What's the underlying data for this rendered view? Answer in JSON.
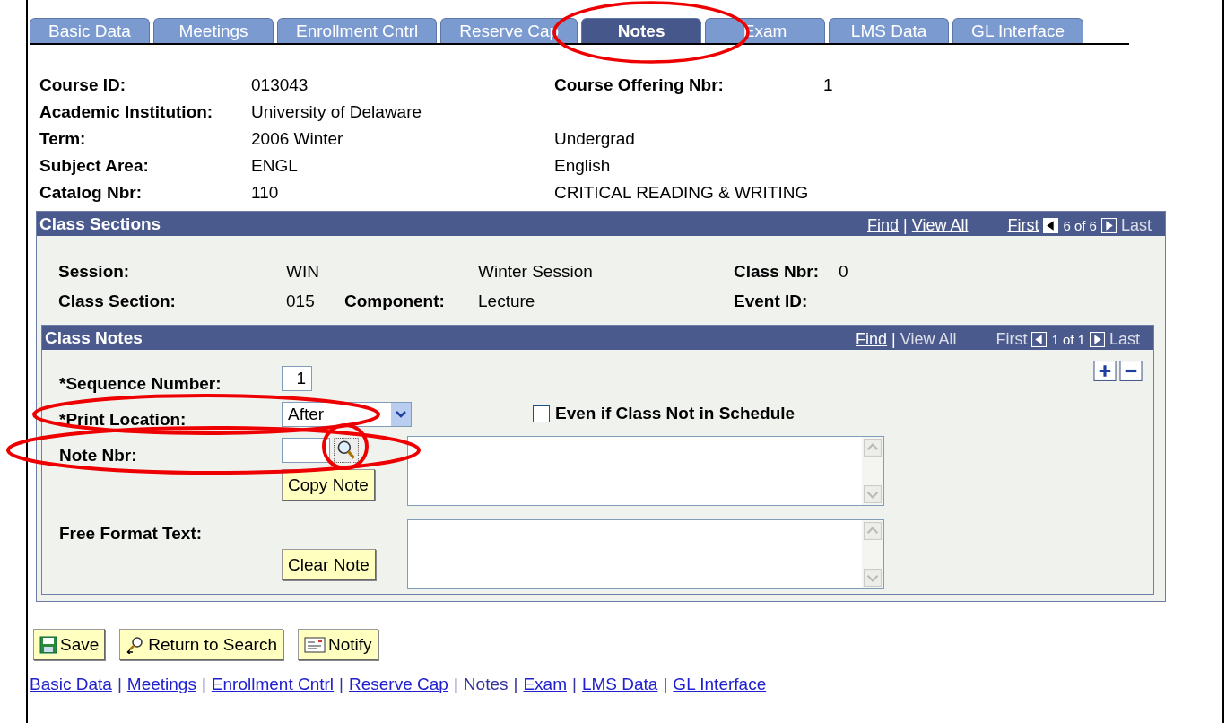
{
  "tabs": [
    {
      "label": "Basic Data",
      "selected": false
    },
    {
      "label": "Meetings",
      "selected": false
    },
    {
      "label": "Enrollment Cntrl",
      "selected": false
    },
    {
      "label": "Reserve Cap",
      "selected": false
    },
    {
      "label": "Notes",
      "selected": true
    },
    {
      "label": "Exam",
      "selected": false
    },
    {
      "label": "LMS Data",
      "selected": false
    },
    {
      "label": "GL Interface",
      "selected": false
    }
  ],
  "header_fields": [
    {
      "label": "Course ID:",
      "value": "013043",
      "label_2": "Course Offering Nbr:",
      "value_2": "1"
    },
    {
      "label": "Academic Institution:",
      "value": "University of Delaware"
    },
    {
      "label": "Term:",
      "value": "2006 Winter",
      "value_2": "Undergrad"
    },
    {
      "label": "Subject Area:",
      "value": "ENGL",
      "value_2": "English"
    },
    {
      "label": "Catalog Nbr:",
      "value": "110",
      "value_2": "CRITICAL READING & WRITING"
    }
  ],
  "class_sections": {
    "title": "Class Sections",
    "nav": {
      "find": "Find",
      "separator": "|",
      "view_all": "View All",
      "view_all_enabled": true,
      "first": "First",
      "first_enabled": true,
      "counter": "6 of 6",
      "last": "Last",
      "last_enabled": false
    },
    "rows": [
      {
        "label": "Session:",
        "value": "WIN",
        "value_2": "Winter Session",
        "label_3": "Class Nbr:",
        "value_3": "0"
      },
      {
        "label": "Class Section:",
        "value": "015",
        "label_2": "Component:",
        "value_2": "Lecture",
        "label_3": "Event ID:"
      }
    ],
    "class_notes": {
      "title": "Class Notes",
      "nav": {
        "find": "Find",
        "separator": "|",
        "view_all": "View All",
        "view_all_enabled": false,
        "first": "First",
        "first_enabled": false,
        "counter": "1 of 1",
        "last": "Last",
        "last_enabled": false
      },
      "sequence_label": "*Sequence Number:",
      "sequence_value": "1",
      "print_location_label": "*Print Location:",
      "print_location_value": "After",
      "even_if_label": "Even if Class Not in Schedule",
      "even_if_checked": false,
      "note_nbr_label": "Note Nbr:",
      "copy_button": "Copy Note",
      "free_format_label": "Free Format Text:",
      "clear_button": "Clear Note"
    }
  },
  "action_buttons": [
    {
      "label": "Save",
      "kind": "save"
    },
    {
      "label": "Return to Search",
      "kind": "search"
    },
    {
      "label": "Notify",
      "kind": "notify"
    }
  ],
  "footer": {
    "separator": "|",
    "links": [
      {
        "label": "Basic Data",
        "selected": false
      },
      {
        "label": "Meetings",
        "selected": false
      },
      {
        "label": "Enrollment Cntrl",
        "selected": false
      },
      {
        "label": "Reserve Cap",
        "selected": false
      },
      {
        "label": "Notes",
        "selected": true
      },
      {
        "label": "Exam",
        "selected": false
      },
      {
        "label": "LMS Data",
        "selected": false
      },
      {
        "label": "GL Interface",
        "selected": false
      }
    ]
  }
}
